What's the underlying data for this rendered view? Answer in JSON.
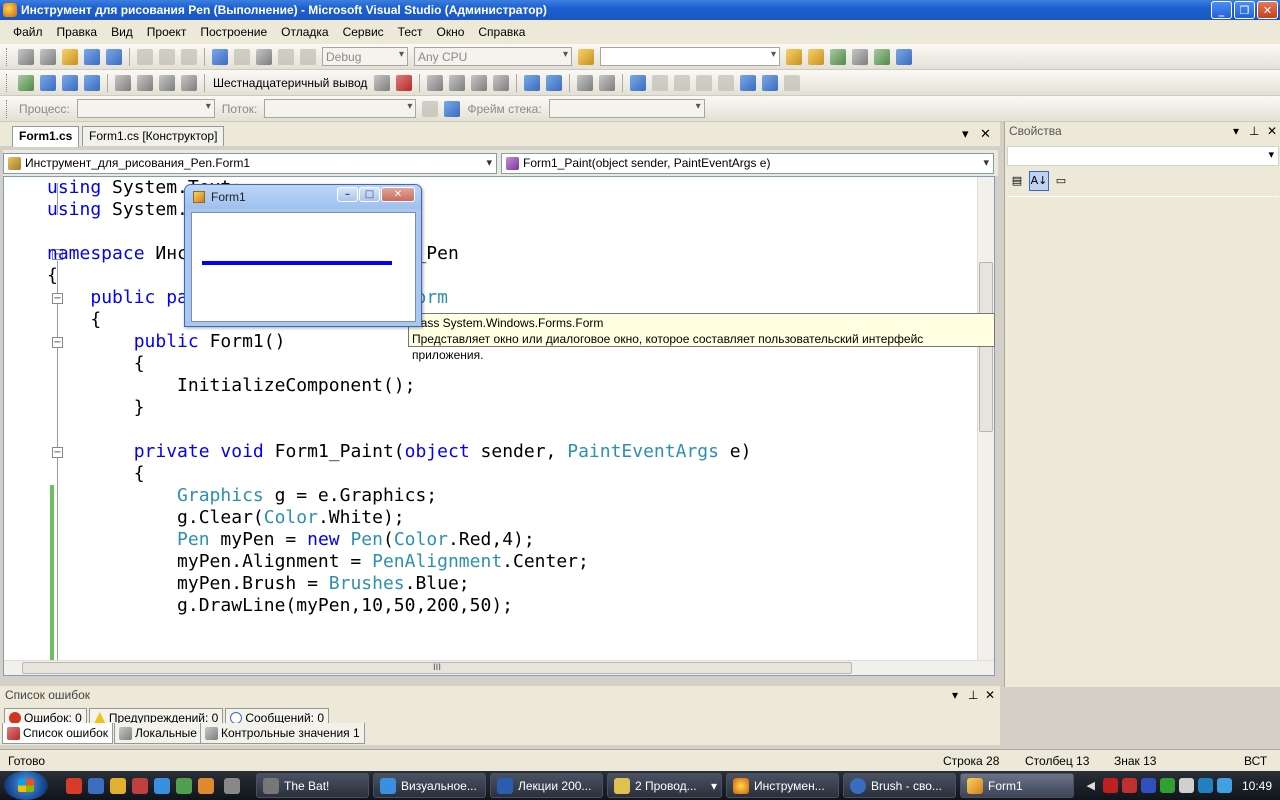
{
  "window": {
    "title": "Инструмент для рисования Pen (Выполнение) - Microsoft Visual Studio (Администратор)"
  },
  "menu": [
    "Файл",
    "Правка",
    "Вид",
    "Проект",
    "Построение",
    "Отладка",
    "Сервис",
    "Тест",
    "Окно",
    "Справка"
  ],
  "toolbar1": {
    "config": "Debug",
    "platform": "Any CPU"
  },
  "toolbar2": {
    "hex_label": "Шестнадцатеричный вывод"
  },
  "toolbar3": {
    "process_label": "Процесс:",
    "thread_label": "Поток:",
    "stack_label": "Фрейм стека:"
  },
  "tabs": [
    {
      "label": "Form1.cs"
    },
    {
      "label": "Form1.cs [Конструктор]"
    }
  ],
  "nav": {
    "type_combo": "Инструмент_для_рисования_Pen.Form1",
    "member_combo": "Form1_Paint(object sender, PaintEventArgs e)"
  },
  "code": [
    "using System.Text;",
    "using System.Windows.Forms;",
    "",
    "namespace Инструмент_для_рисования_Pen",
    "{",
    "    public partial class Form1 : Form",
    "    {",
    "        public Form1()",
    "        {",
    "            InitializeComponent();",
    "        }",
    "",
    "        private void Form1_Paint(object sender, PaintEventArgs e)",
    "        {",
    "            Graphics g = e.Graphics;",
    "            g.Clear(Color.White);",
    "            Pen myPen = new Pen(Color.Red,4);",
    "            myPen.Alignment = PenAlignment.Center;",
    "            myPen.Brush = Brushes.Blue;",
    "            g.DrawLine(myPen,10,50,200,50);"
  ],
  "tooltip": {
    "line1": "class System.Windows.Forms.Form",
    "line2": "Представляет окно или диалоговое окно, которое составляет пользовательский интерфейс приложения."
  },
  "form1": {
    "title": "Form1",
    "line_color": "#0000ff"
  },
  "properties": {
    "title": "Свойства"
  },
  "errorlist": {
    "title": "Список ошибок",
    "errors": "Ошибок: 0",
    "warnings": "Предупреждений: 0",
    "messages": "Сообщений: 0"
  },
  "bottom_tabs": [
    "Список ошибок",
    "Локальные",
    "Контрольные значения 1"
  ],
  "status": {
    "ready": "Готово",
    "row": "Строка 28",
    "col": "Столбец 13",
    "char": "Знак 13",
    "mode": "ВСТ"
  },
  "taskbar": {
    "tasks": [
      "The Bat!",
      "Визуальное...",
      "Лекции 200...",
      "2 Провод...",
      "Инструмен...",
      "Brush - сво...",
      "Form1"
    ],
    "clock": "10:49"
  }
}
